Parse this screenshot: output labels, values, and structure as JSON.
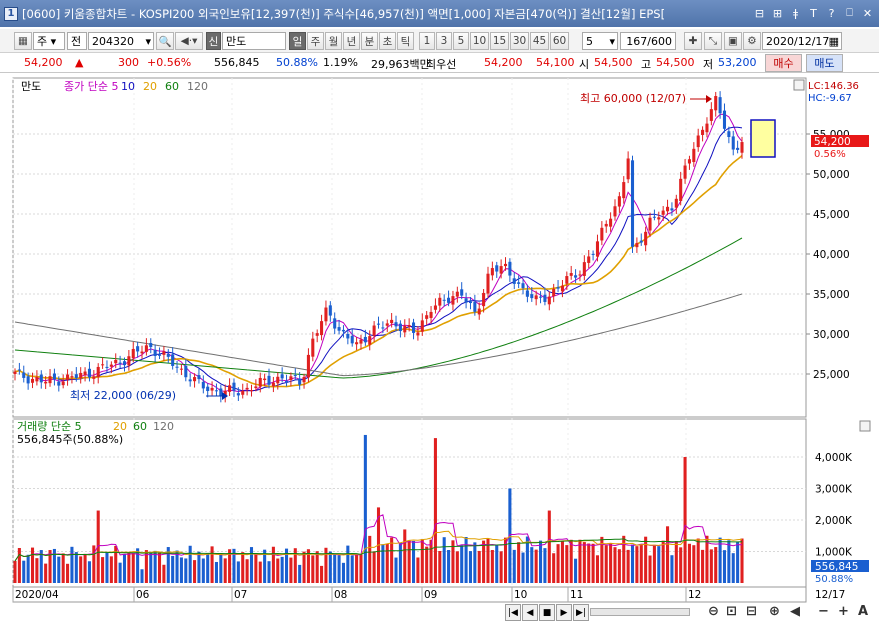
{
  "window": {
    "icon": "1",
    "title": "[0600] 키움종합차트 - KOSPI200 외국인보유[12,397(천)] 주식수[46,957(천)] 액면[1,000] 자본금[470(억)] 결산[12월] EPS[",
    "buttons": [
      "minimize-icon",
      "restore-icon",
      "text-icon",
      "help-icon",
      "text-mode-icon",
      "close-icon"
    ],
    "button_glyphs": [
      "⊟",
      "⊞",
      "ǂ",
      "T",
      "?",
      "⎕",
      "✕"
    ]
  },
  "toolbar": {
    "period_type": "주",
    "period_sel": "전",
    "code": "204320",
    "name": "만도",
    "cycles": [
      "일",
      "주",
      "월",
      "년",
      "분",
      "초",
      "틱"
    ],
    "cycle_selected": "일",
    "nums": [
      "1",
      "3",
      "5",
      "10",
      "15",
      "30",
      "45",
      "60"
    ],
    "interval": "5",
    "count": "167/600",
    "date": "2020/12/17",
    "prefix": "신"
  },
  "quote": {
    "price": "54,200",
    "arrow": "▲",
    "change": "300",
    "rate": "+0.56%",
    "volume": "556,845",
    "vol_ratio": "50.88%",
    "turnover": "1.19%",
    "amount": "29,963백만",
    "broker": "최우선",
    "ask": "54,200",
    "bid": "54,100",
    "open_label": "시",
    "open": "54,500",
    "high_label": "고",
    "high": "54,500",
    "low_label": "저",
    "low": "53,200",
    "buy": "매수",
    "sell": "매도"
  },
  "price_panel": {
    "name": "만도",
    "legend": [
      {
        "label": "종가 단순 5",
        "color": "#c000c0"
      },
      {
        "label": "10",
        "color": "#1010c0"
      },
      {
        "label": "20",
        "color": "#e0a000"
      },
      {
        "label": "60",
        "color": "#108010"
      },
      {
        "label": "120",
        "color": "#707070"
      }
    ],
    "lc": "LC:146.36",
    "hc": "HC:-9.67",
    "last_price": "54,200",
    "last_rate": "0.56%",
    "annot_high": "최고 60,000 (12/07)",
    "annot_low": "최저 22,000 (06/29)",
    "yticks": [
      "55,000",
      "50,000",
      "45,000",
      "40,000",
      "35,000",
      "30,000",
      "25,000"
    ]
  },
  "volume_panel": {
    "legend": [
      {
        "label": "거래량 단순 5",
        "color": "#c000c0"
      },
      {
        "label": "20",
        "color": "#e0a000"
      },
      {
        "label": "60",
        "color": "#108010"
      },
      {
        "label": "120",
        "color": "#707070"
      }
    ],
    "current": "556,845주(50.88%)",
    "last_vol": "556,845",
    "last_ratio": "50.88%",
    "yticks": [
      "4,000K",
      "3,000K",
      "2,000K",
      "1,000K"
    ]
  },
  "xaxis": {
    "labels": [
      "2020/04",
      "06",
      "07",
      "08",
      "09",
      "10",
      "11",
      "12"
    ],
    "end_date": "12/17"
  },
  "colors": {
    "up": "#e02020",
    "down": "#1a5fd0",
    "ma5": "#c000c0",
    "ma10": "#1010c0",
    "ma20": "#e0a000",
    "ma60": "#108010",
    "ma120": "#707070"
  },
  "chart_data": {
    "type": "candlestick",
    "ma_lines": {
      "ma20_start": 23000,
      "ma20_end": 51000,
      "ma60_start": 28000,
      "ma60_end": 42000,
      "ma120_start": 31500,
      "ma120_end": 35000
    },
    "ylim": [
      20000,
      62000
    ],
    "volume_ylim": [
      0,
      4800000
    ],
    "high": 60000,
    "low": 22000,
    "last": 54200
  }
}
